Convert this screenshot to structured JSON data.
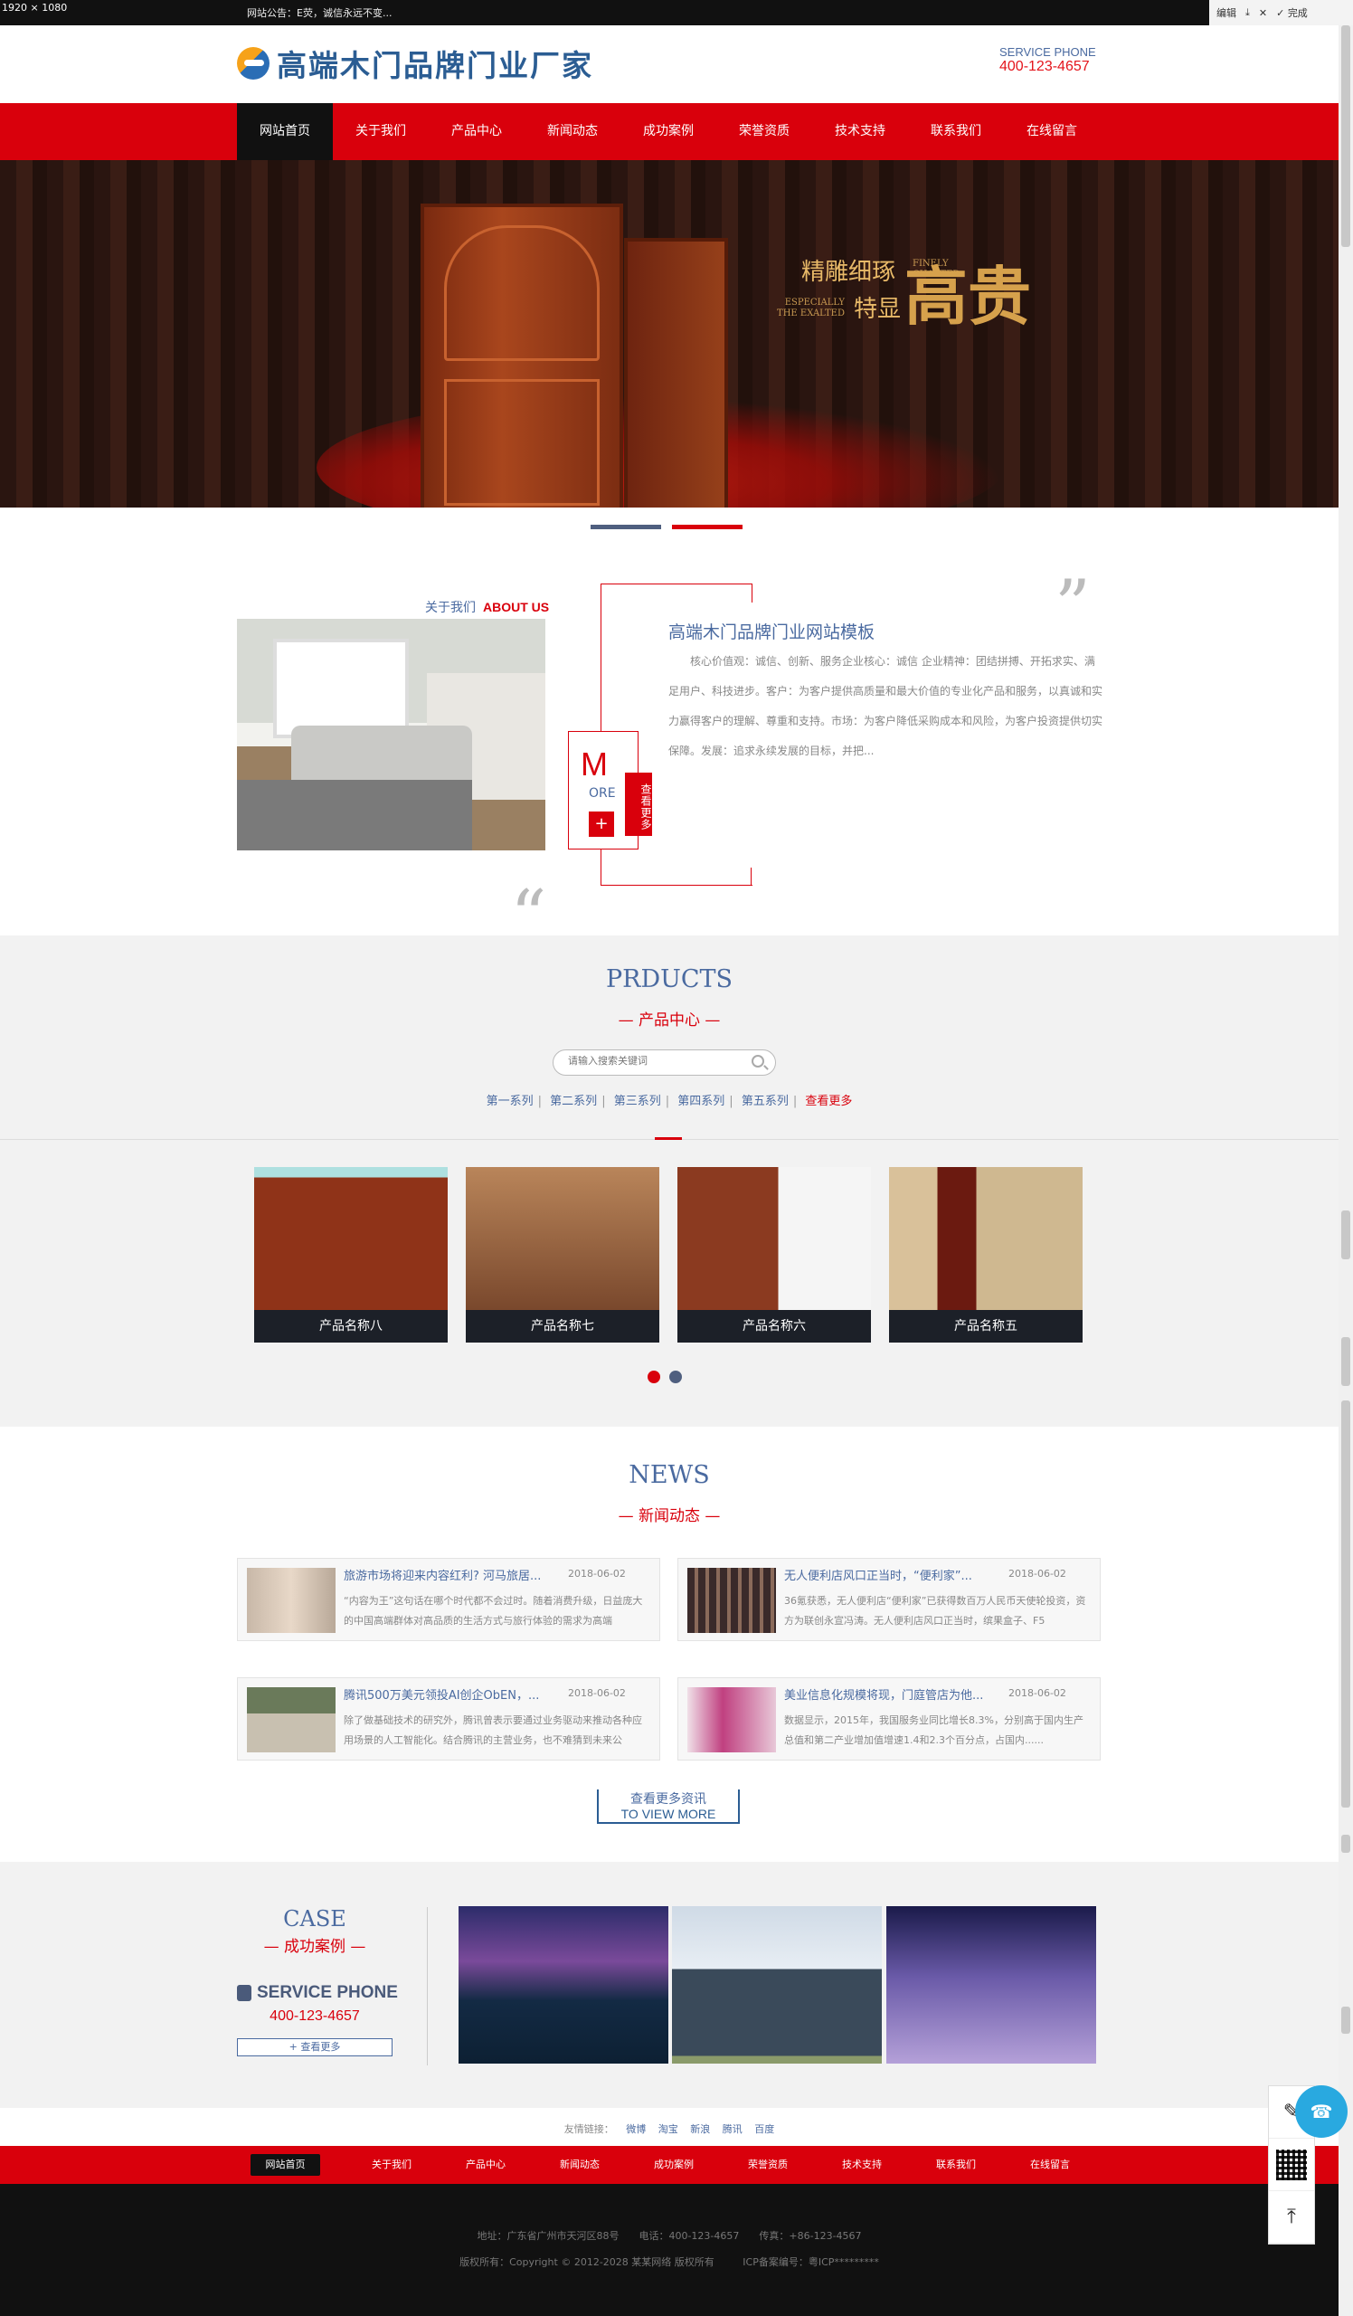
{
  "topbar": {
    "resolution": "1920 × 1080",
    "notice": "网站公告：E荧，诚信永远不变...",
    "tools": {
      "edit": "编辑",
      "download": "⤓",
      "close": "✕",
      "done": "完成"
    }
  },
  "header": {
    "logo_text": "高端木门品牌门业厂家",
    "service_label": "SERVICE PHONE",
    "service_phone": "400-123-4657"
  },
  "nav": [
    "网站首页",
    "关于我们",
    "产品中心",
    "新闻动态",
    "成功案例",
    "荣誉资质",
    "技术支持",
    "联系我们",
    "在线留言"
  ],
  "banner": {
    "line1": "精雕细琢",
    "line1_en": "FINELY CHAFTED",
    "line2_en": "ESPECIALLY THE EXALTED",
    "line2": "特显",
    "big": "高贵"
  },
  "about": {
    "label_cn": "关于我们",
    "label_en": "ABOUT US",
    "title": "高端木门品牌门业网站模板",
    "text": "核心价值观：诚信、创新、服务企业核心：诚信 企业精神：团结拼搏、开拓求实、满足用户、科技进步。客户：为客户提供高质量和最大价值的专业化产品和服务，以真诚和实力赢得客户的理解、尊重和支持。市场：为客户降低采购成本和风险，为客户投资提供切实保障。发展：追求永续发展的目标，并把...",
    "more_m": "M",
    "more_ore": "ORE",
    "more_side": "查看更多",
    "more_plus": "+",
    "quote": "”"
  },
  "products": {
    "title_en": "PRDUCTS",
    "title_cn": "— 产品中心 —",
    "search_placeholder": "请输入搜索关键词",
    "series": [
      "第一系列",
      "第二系列",
      "第三系列",
      "第四系列",
      "第五系列",
      "查看更多"
    ],
    "items": [
      {
        "name": "产品名称八"
      },
      {
        "name": "产品名称七"
      },
      {
        "name": "产品名称六"
      },
      {
        "name": "产品名称五"
      }
    ]
  },
  "news": {
    "title_en": "NEWS",
    "title_cn": "— 新闻动态 —",
    "items": [
      {
        "title": "旅游市场将迎来内容红利? 河马旅居...",
        "date": "2018-06-02",
        "desc": "“内容为王”这句话在哪个时代都不会过时。随着消费升级，日益庞大的中国高端群体对高品质的生活方式与旅行体验的需求为高端"
      },
      {
        "title": "无人便利店风口正当时，“便利家”...",
        "date": "2018-06-02",
        "desc": "36氪获悉，无人便利店“便利家”已获得数百万人民币天使轮投资，资方为联创永宣冯涛。无人便利店风口正当时，缤果盒子、F5"
      },
      {
        "title": "腾讯500万美元领投AI创企ObEN，...",
        "date": "2018-06-02",
        "desc": "除了做基础技术的研究外，腾讯曾表示要通过业务驱动来推动各种应用场景的人工智能化。结合腾讯的主营业务，也不难猜到未来公"
      },
      {
        "title": "美业信息化规模将现，门庭管店为他...",
        "date": "2018-06-02",
        "desc": "数据显示，2015年，我国服务业同比增长8.3%，分别高于国内生产总值和第二产业增加值增速1.4和2.3个百分点，占国内......"
      }
    ],
    "more_cn": "查看更多资讯",
    "more_en": "TO VIEW MORE"
  },
  "case": {
    "title_en": "CASE",
    "title_cn": "— 成功案例 —",
    "service_label": "SERVICE PHONE",
    "phone": "400-123-4657",
    "more": "+ 查看更多"
  },
  "links": {
    "label": "友情链接：",
    "items": [
      "微博",
      "淘宝",
      "新浪",
      "腾讯",
      "百度"
    ]
  },
  "footer": {
    "address": "地址：广东省广州市天河区88号　　电话：400-123-4657　　传真：+86-123-4567",
    "copyright": "版权所有：Copyright © 2012-2028 某某网络 版权所有",
    "icp": "ICP备案编号：粤ICP*********"
  }
}
